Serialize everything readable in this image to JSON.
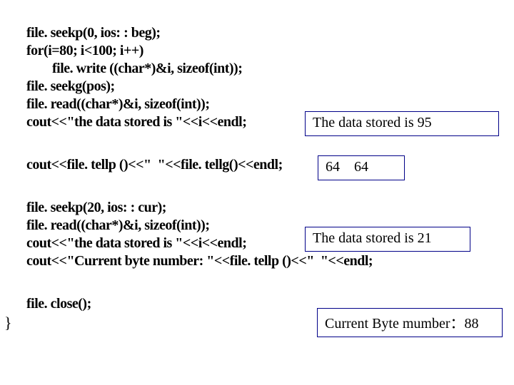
{
  "code": {
    "l1": "file. seekp(0, ios: : beg);",
    "l2": "for(i=80; i<100; i++)",
    "l3": "        file. write ((char*)&i, sizeof(int));",
    "l4": "file. seekg(pos);",
    "l5": "file. read((char*)&i, sizeof(int));",
    "l6": "cout<<\"the data stored is \"<<i<<endl;",
    "l7": "cout<<file. tellp ()<<\"  \"<<file. tellg()<<endl;",
    "l8": "file. seekp(20, ios: : cur);",
    "l9": "file. read((char*)&i, sizeof(int));",
    "l10": "cout<<\"the data stored is \"<<i<<endl;",
    "l11": "cout<<\"Current byte number: \"<<file. tellp ()<<\"  \"<<endl;",
    "l12": "file. close();",
    "l13": "}"
  },
  "outputs": {
    "o1": "The data stored is 95",
    "o2": "64    64",
    "o3": "The data stored is 21",
    "o4": "Current Byte mumber：88"
  }
}
